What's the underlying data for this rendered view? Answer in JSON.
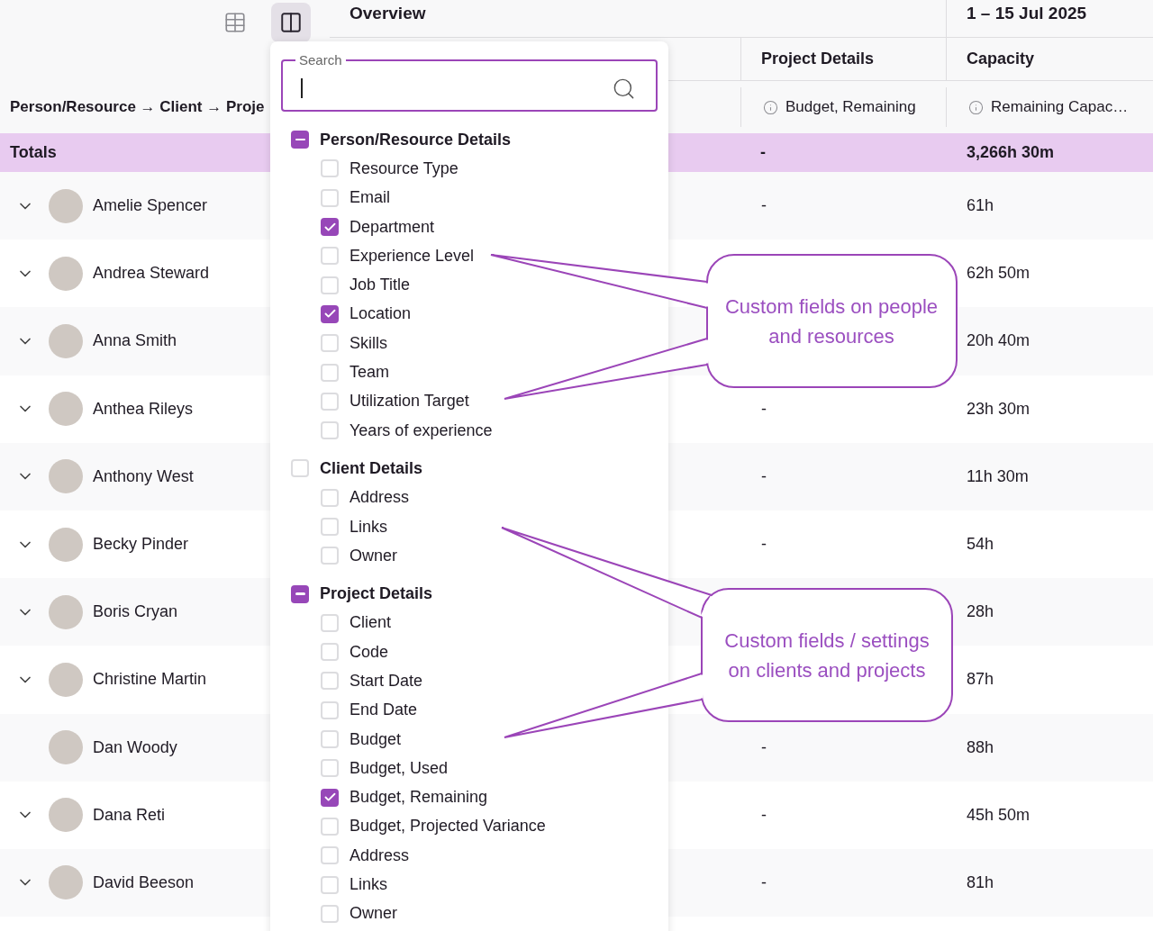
{
  "toolbar": [
    {
      "kind": "table",
      "selected": false
    },
    {
      "kind": "columns",
      "selected": true
    }
  ],
  "header": {
    "title": "Overview",
    "date_range": "1 – 15 Jul 2025",
    "column_groups": [
      "Project Details",
      "Capacity"
    ],
    "grouping": "Person/Resource → Client → Proje",
    "columns": [
      "Budget, Remaining",
      "Remaining Capac…"
    ]
  },
  "totals": {
    "label": "Totals",
    "budget_remaining": "-",
    "capacity": "3,266h 30m"
  },
  "rows": [
    {
      "name": "Amelie Spencer",
      "expandable": true,
      "budget_remaining": "-",
      "capacity": "61h"
    },
    {
      "name": "Andrea Steward",
      "expandable": true,
      "capacity": "62h 50m"
    },
    {
      "name": "Anna Smith",
      "expandable": true,
      "capacity": "20h 40m"
    },
    {
      "name": "Anthea Rileys",
      "expandable": true,
      "budget_remaining": "-",
      "capacity": "23h 30m"
    },
    {
      "name": "Anthony West",
      "expandable": true,
      "budget_remaining": "-",
      "capacity": "11h 30m"
    },
    {
      "name": "Becky Pinder",
      "expandable": true,
      "budget_remaining": "-",
      "capacity": "54h"
    },
    {
      "name": "Boris Cryan",
      "expandable": true,
      "capacity": "28h"
    },
    {
      "name": "Christine Martin",
      "expandable": true,
      "capacity": "87h"
    },
    {
      "name": "Dan Woody",
      "expandable": false,
      "budget_remaining": "-",
      "capacity": "88h"
    },
    {
      "name": "Dana Reti",
      "expandable": true,
      "budget_remaining": "-",
      "capacity": "45h 50m"
    },
    {
      "name": "David Beeson",
      "expandable": true,
      "budget_remaining": "-",
      "capacity": "81h"
    }
  ],
  "column_picker": {
    "search": {
      "label": "Search"
    },
    "groups": [
      {
        "label": "Person/Resource Details",
        "indeterminate": true,
        "items": [
          {
            "label": "Resource Type",
            "checked": false
          },
          {
            "label": "Email",
            "checked": false
          },
          {
            "label": "Department",
            "checked": true
          },
          {
            "label": "Experience Level",
            "checked": false
          },
          {
            "label": "Job Title",
            "checked": false
          },
          {
            "label": "Location",
            "checked": true
          },
          {
            "label": "Skills",
            "checked": false
          },
          {
            "label": "Team",
            "checked": false
          },
          {
            "label": "Utilization Target",
            "checked": false
          },
          {
            "label": "Years of experience",
            "checked": false
          }
        ]
      },
      {
        "label": "Client Details",
        "indeterminate": false,
        "items": [
          {
            "label": "Address",
            "checked": false
          },
          {
            "label": "Links",
            "checked": false
          },
          {
            "label": "Owner",
            "checked": false
          }
        ]
      },
      {
        "label": "Project Details",
        "indeterminate": true,
        "items": [
          {
            "label": "Client",
            "checked": false
          },
          {
            "label": "Code",
            "checked": false
          },
          {
            "label": "Start Date",
            "checked": false
          },
          {
            "label": "End Date",
            "checked": false
          },
          {
            "label": "Budget",
            "checked": false
          },
          {
            "label": "Budget, Used",
            "checked": false
          },
          {
            "label": "Budget, Remaining",
            "checked": true
          },
          {
            "label": "Budget, Projected Variance",
            "checked": false
          },
          {
            "label": "Address",
            "checked": false
          },
          {
            "label": "Links",
            "checked": false
          },
          {
            "label": "Owner",
            "checked": false
          }
        ]
      }
    ]
  },
  "callouts": [
    {
      "text": "Custom fields on people and resources"
    },
    {
      "text": "Custom fields / settings on clients and projects"
    }
  ]
}
